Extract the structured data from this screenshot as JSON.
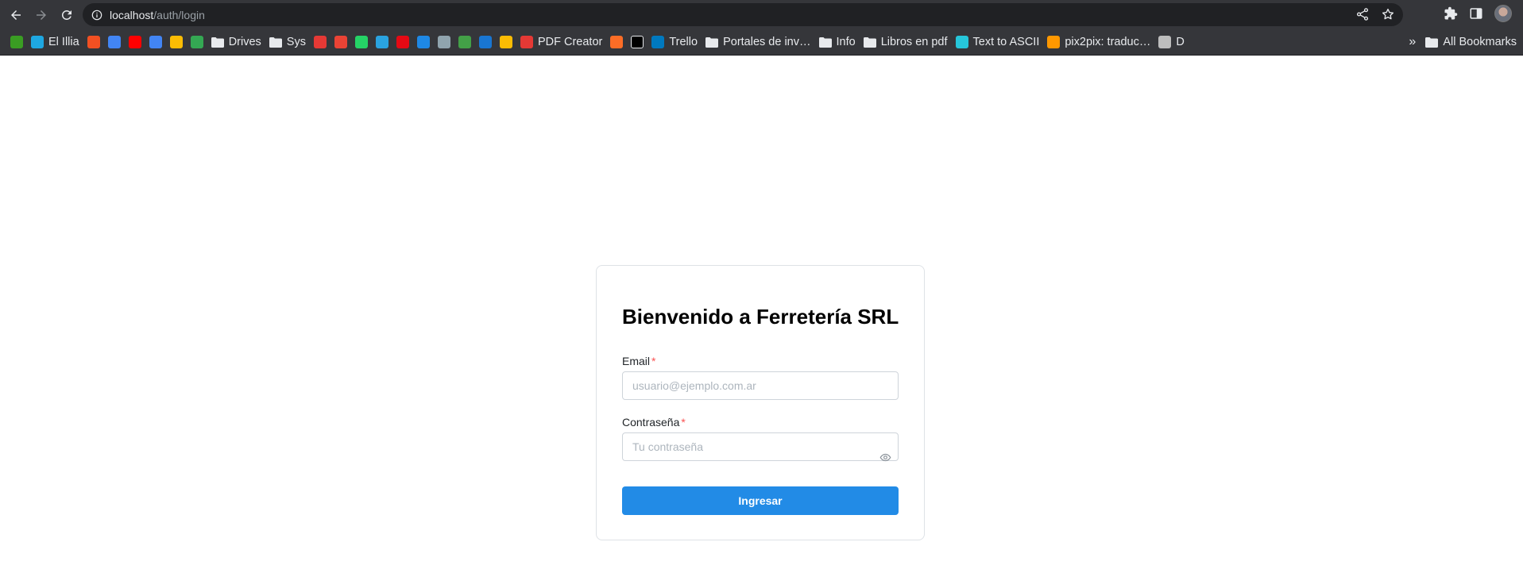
{
  "browser": {
    "url_host": "localhost",
    "url_path": "/auth/login",
    "bookmarks": [
      {
        "label": "",
        "icon": "eiw-favicon",
        "color": "#3a9d23"
      },
      {
        "label": "El Illia",
        "icon": "illia-favicon",
        "color": "#1ea7e1"
      },
      {
        "label": "",
        "icon": "microsoft-favicon",
        "color": "#f25022"
      },
      {
        "label": "",
        "icon": "calendar-favicon",
        "color": "#4285f4"
      },
      {
        "label": "",
        "icon": "youtube-favicon",
        "color": "#ff0000"
      },
      {
        "label": "",
        "icon": "translate-favicon",
        "color": "#4285f4"
      },
      {
        "label": "",
        "icon": "photos-favicon",
        "color": "#fbbc04"
      },
      {
        "label": "",
        "icon": "drive-favicon",
        "color": "#34a853"
      },
      {
        "label": "Drives",
        "icon": "folder-icon",
        "color": ""
      },
      {
        "label": "Sys",
        "icon": "folder-icon",
        "color": ""
      },
      {
        "label": "",
        "icon": "star-favicon",
        "color": "#e53935"
      },
      {
        "label": "",
        "icon": "gmail-favicon",
        "color": "#ea4335"
      },
      {
        "label": "",
        "icon": "whatsapp-favicon",
        "color": "#25d366"
      },
      {
        "label": "",
        "icon": "telegram-favicon",
        "color": "#2aa3e0"
      },
      {
        "label": "",
        "icon": "netflix-favicon",
        "color": "#e50914"
      },
      {
        "label": "",
        "icon": "play-favicon",
        "color": "#1e88e5"
      },
      {
        "label": "",
        "icon": "app-favicon",
        "color": "#90a4ae"
      },
      {
        "label": "",
        "icon": "sheet-favicon",
        "color": "#43a047"
      },
      {
        "label": "",
        "icon": "doc-favicon",
        "color": "#1976d2"
      },
      {
        "label": "",
        "icon": "image-favicon",
        "color": "#fbbc04"
      },
      {
        "label": "PDF Creator",
        "icon": "pdf-favicon",
        "color": "#e53935"
      },
      {
        "label": "",
        "icon": "gitlab-favicon",
        "color": "#fc6d26"
      },
      {
        "label": "",
        "icon": "x-favicon",
        "color": "#000000"
      },
      {
        "label": "Trello",
        "icon": "trello-favicon",
        "color": "#0079bf"
      },
      {
        "label": "Portales de inv…",
        "icon": "folder-icon",
        "color": ""
      },
      {
        "label": "Info",
        "icon": "folder-icon",
        "color": ""
      },
      {
        "label": "Libros en pdf",
        "icon": "folder-icon",
        "color": ""
      },
      {
        "label": "Text to ASCII",
        "icon": "ascii-favicon",
        "color": "#26c6da"
      },
      {
        "label": "pix2pix: traduc…",
        "icon": "pix2pix-favicon",
        "color": "#ff9800"
      },
      {
        "label": "D",
        "icon": "globe-favicon",
        "color": "#bdbdbd"
      }
    ],
    "all_bookmarks_label": "All Bookmarks"
  },
  "login": {
    "title": "Bienvenido a Ferretería SRL",
    "email_label": "Email",
    "email_placeholder": "usuario@ejemplo.com.ar",
    "password_label": "Contraseña",
    "password_placeholder": "Tu contraseña",
    "required_mark": "*",
    "submit_label": "Ingresar"
  },
  "colors": {
    "primary": "#228be6",
    "required": "#fa5252",
    "chrome_bg": "#35363a"
  }
}
